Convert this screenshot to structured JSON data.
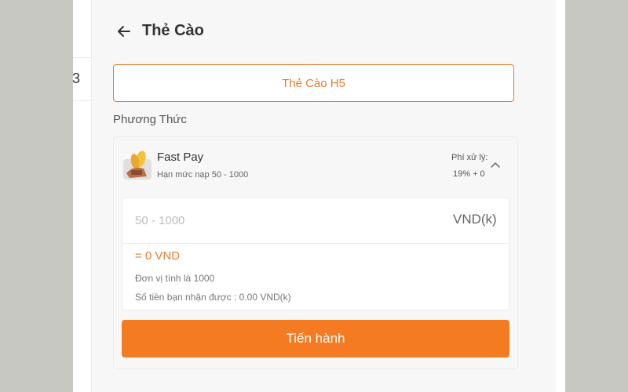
{
  "sidebar": {
    "item_number": "3"
  },
  "header": {
    "title": "Thẻ Cào",
    "back_icon": "arrow-left-icon"
  },
  "card_type_button": "Thẻ Cào H5",
  "section": {
    "label": "Phương Thức"
  },
  "method": {
    "name": "Fast Pay",
    "limit": "Hạn mức nạp 50 - 1000",
    "fee_label": "Phí xử lý:",
    "fee_value": "19% + 0",
    "icon": "card-wallet-icon",
    "chevron": "chevron-up-icon"
  },
  "amount": {
    "placeholder": "50 - 1000",
    "value": "",
    "unit": "VND(k)",
    "converted": "= 0 VND",
    "note_unit": "Đơn vị tính là 1000",
    "note_received": "Số tiền bạn nhận được : 0.00 VND(k)"
  },
  "proceed_label": "Tiến hành",
  "colors": {
    "accent": "#f47b21",
    "accent_text": "#e87c2e"
  }
}
